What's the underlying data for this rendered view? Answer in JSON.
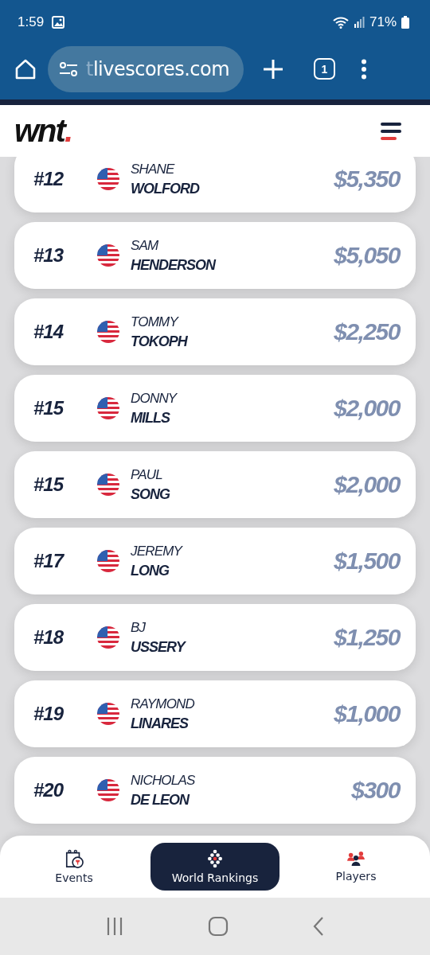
{
  "status_bar": {
    "time": "1:59",
    "battery": "71%"
  },
  "browser": {
    "url": "tlivescores.com",
    "tab_count": "1"
  },
  "site": {
    "logo": "wnt",
    "logo_dot": "."
  },
  "rankings": [
    {
      "rank": "#12",
      "first_name": "SHANE",
      "last_name": "WOLFORD",
      "prize": "$5,350"
    },
    {
      "rank": "#13",
      "first_name": "SAM",
      "last_name": "HENDERSON",
      "prize": "$5,050"
    },
    {
      "rank": "#14",
      "first_name": "TOMMY",
      "last_name": "TOKOPH",
      "prize": "$2,250"
    },
    {
      "rank": "#15",
      "first_name": "DONNY",
      "last_name": "MILLS",
      "prize": "$2,000"
    },
    {
      "rank": "#15",
      "first_name": "PAUL",
      "last_name": "SONG",
      "prize": "$2,000"
    },
    {
      "rank": "#17",
      "first_name": "JEREMY",
      "last_name": "LONG",
      "prize": "$1,500"
    },
    {
      "rank": "#18",
      "first_name": "BJ",
      "last_name": "USSERY",
      "prize": "$1,250"
    },
    {
      "rank": "#19",
      "first_name": "RAYMOND",
      "last_name": "LINARES",
      "prize": "$1,000"
    },
    {
      "rank": "#20",
      "first_name": "NICHOLAS",
      "last_name": "DE LEON",
      "prize": "$300"
    }
  ],
  "bottom_nav": [
    {
      "kind": "events",
      "label": "Events",
      "selected": false
    },
    {
      "kind": "rankings",
      "label": "World Rankings",
      "selected": true
    },
    {
      "kind": "players",
      "label": "Players",
      "selected": false
    }
  ]
}
